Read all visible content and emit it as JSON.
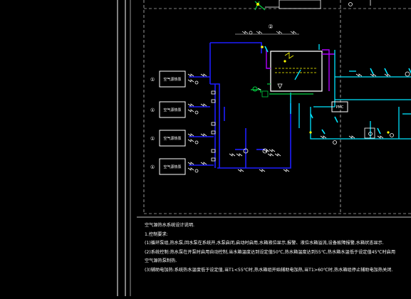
{
  "drawing": {
    "colors": {
      "background": "#000000",
      "frame": "#ffffff",
      "supply_pipe": "#1e1eff",
      "water_pipe": "#00e5ff",
      "condensate_pipe": "#b000ff",
      "gas_pipe": "#00d040",
      "valve": "#ffffff",
      "label": "#ffff00"
    },
    "unit_labels": [
      "空气源热泵",
      "空气源热泵",
      "空气源热泵",
      "空气源热泵"
    ],
    "unit_numbers": [
      "①",
      "①",
      "①",
      "①"
    ],
    "equipment_tags": [
      "PMC",
      "②"
    ]
  },
  "notes": {
    "title": "空气源热水系统设计说明.",
    "section1": "1.控制要求:",
    "line1": "(1)循环泵组,热水泵,回水泵在系统开,水泵启闭,启动时启用,水箱液位显示,报警、液位水箱溢流,设备故障报警,水箱状态显示.",
    "line2": "(2)系统控制:热水泵在开泵时启用自动控制,当水箱温度达到设定值50℃,热水箱温度达到55℃,热水箱水温低于设定值45℃时启用",
    "line3": "空气源热泵制热.",
    "line4": "(3)辅助电加热:系统热水温度低于设定值,当T1<55℃时,热水箱组开始辅助电加热,当T1>60℃时,热水箱组停止辅助电加热关闭."
  }
}
